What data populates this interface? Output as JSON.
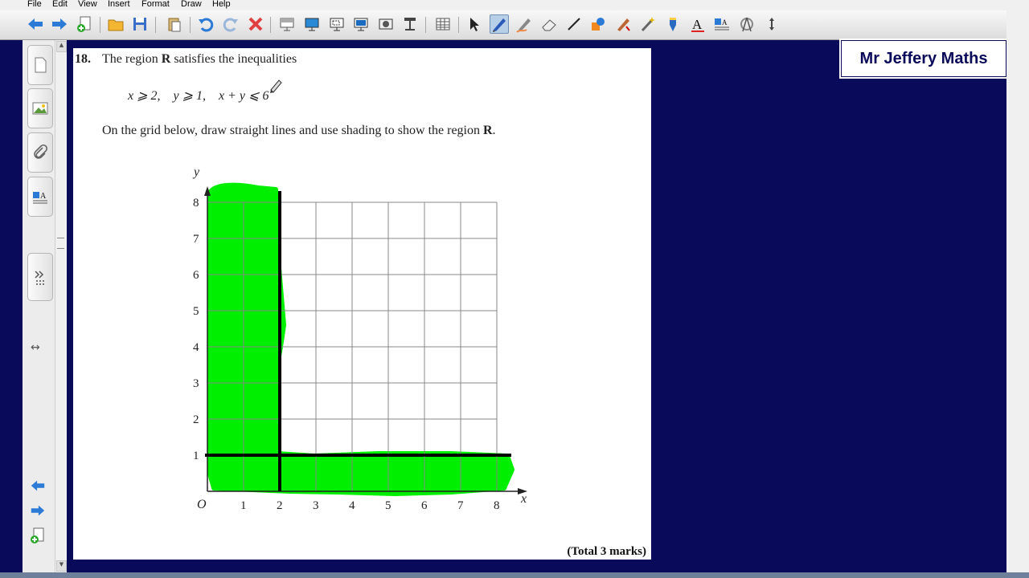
{
  "menu": {
    "items": [
      "File",
      "Edit",
      "View",
      "Insert",
      "Format",
      "Draw",
      "Help"
    ]
  },
  "toolbar": {
    "icons": [
      "back-arrow-icon",
      "forward-arrow-icon",
      "add-page-icon",
      "open-folder-icon",
      "save-icon",
      "paste-icon",
      "undo-icon",
      "redo-icon",
      "delete-icon",
      "screen-shade-icon",
      "display-icon",
      "capture-icon",
      "monitor-icon",
      "screen-recorder-icon",
      "document-camera-icon",
      "table-icon",
      "select-pointer-icon",
      "pen-icon",
      "creative-pen-icon",
      "eraser-icon",
      "line-icon",
      "shapes-icon",
      "fill-icon",
      "magic-pen-icon",
      "highlighter-icon",
      "text-icon",
      "properties-icon",
      "measurement-icon",
      "move-toolbar-icon"
    ]
  },
  "brand": {
    "label": "Mr Jeffery Maths"
  },
  "question": {
    "number": "18.",
    "text_pre": "The region ",
    "text_bold": "R",
    "text_post": " satisfies the inequalities",
    "ineq1": "x ⩾ 2,",
    "ineq2": "y ⩾ 1,",
    "ineq3": "x + y ⩽ 6",
    "instruction_pre": "On the grid below, draw straight lines and use shading to show the region ",
    "instruction_bold": "R",
    "instruction_post": ".",
    "total": "(Total 3 marks)"
  },
  "graph": {
    "x_label": "x",
    "y_label": "y",
    "origin_label": "O",
    "x_ticks": [
      "1",
      "2",
      "3",
      "4",
      "5",
      "6",
      "7",
      "8"
    ],
    "y_ticks": [
      "1",
      "2",
      "3",
      "4",
      "5",
      "6",
      "7",
      "8"
    ],
    "drawn_lines": [
      {
        "label": "x = 2",
        "x": 2
      },
      {
        "label": "y = 1",
        "y": 1
      }
    ],
    "shading_color": "#00ee00"
  },
  "colors": {
    "background": "#0a0a5a",
    "shading": "#00ee00"
  }
}
